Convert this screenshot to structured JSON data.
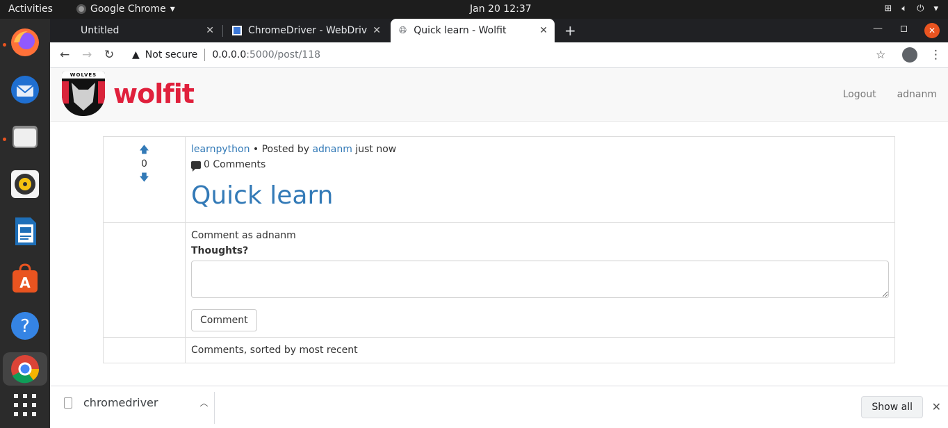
{
  "system": {
    "activities": "Activities",
    "app_name": "Google Chrome",
    "clock": "Jan 20  12:37"
  },
  "tabs": [
    {
      "title": "Untitled"
    },
    {
      "title": "ChromeDriver - WebDrive"
    },
    {
      "title": "Quick learn - Wolfit"
    }
  ],
  "address": {
    "security": "Not secure",
    "host": "0.0.0.0",
    "path": ":5000/post/118"
  },
  "site": {
    "brand": "wolfit",
    "crest_text": "WOLVES",
    "nav": {
      "logout": "Logout",
      "user": "adnanm"
    }
  },
  "post": {
    "score": "0",
    "subreddit": "learnpython",
    "posted_by_text": "• Posted by",
    "author": "adnanm",
    "when": "just now",
    "comments_count": "0 Comments",
    "title": "Quick learn",
    "comment_as": "Comment as adnanm",
    "thoughts_label": "Thoughts?",
    "comment_button": "Comment",
    "comments_heading": "Comments, sorted by most recent"
  },
  "download": {
    "file": "chromedriver",
    "show_all": "Show all"
  },
  "colors": {
    "link": "#337ab7",
    "brand": "#e0203c",
    "ubuntu_orange": "#e95420"
  }
}
